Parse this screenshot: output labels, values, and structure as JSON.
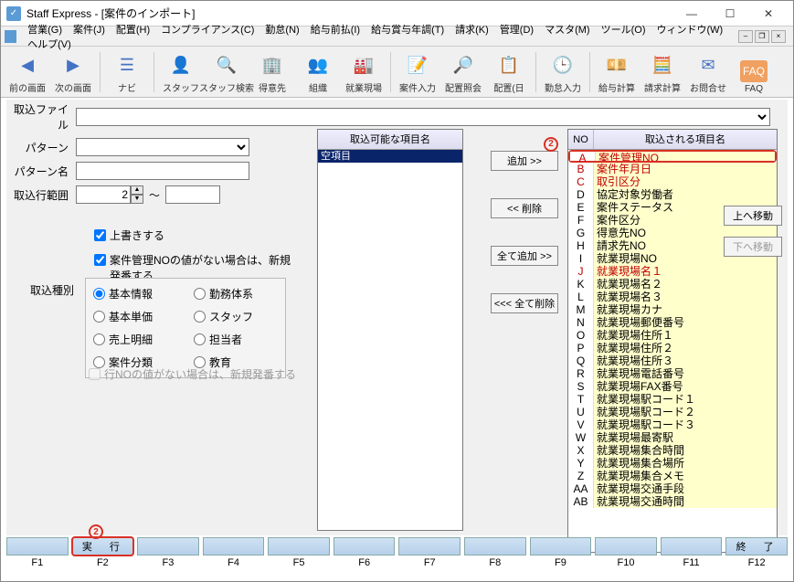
{
  "window": {
    "title": "Staff Express - [案件のインポート]"
  },
  "menus": [
    "営業(G)",
    "案件(J)",
    "配置(H)",
    "コンプライアンス(C)",
    "勤怠(N)",
    "給与前払(I)",
    "給与賞与年調(T)",
    "請求(K)",
    "管理(D)",
    "マスタ(M)",
    "ツール(O)",
    "ウィンドウ(W)",
    "ヘルプ(V)"
  ],
  "toolbar": [
    {
      "icon": "◀",
      "label": "前の画面"
    },
    {
      "icon": "▶",
      "label": "次の画面"
    },
    {
      "sep": true
    },
    {
      "icon": "☰",
      "label": "ナビ"
    },
    {
      "sep": true
    },
    {
      "icon": "👤",
      "label": "スタッフ"
    },
    {
      "icon": "🔍",
      "label": "スタッフ検索"
    },
    {
      "icon": "🏢",
      "label": "得意先"
    },
    {
      "icon": "👥",
      "label": "組織"
    },
    {
      "icon": "🏭",
      "label": "就業現場"
    },
    {
      "sep": true
    },
    {
      "icon": "📝",
      "label": "案件入力"
    },
    {
      "icon": "🔎",
      "label": "配置照会"
    },
    {
      "icon": "📋",
      "label": "配置(日"
    },
    {
      "sep": true
    },
    {
      "icon": "🕒",
      "label": "勤怠入力"
    },
    {
      "sep": true
    },
    {
      "icon": "💴",
      "label": "給与計算"
    },
    {
      "icon": "🧮",
      "label": "請求計算"
    },
    {
      "icon": "✉",
      "label": "お問合せ"
    },
    {
      "icon": "❓",
      "label": "FAQ",
      "bg": "#f0a060"
    }
  ],
  "labels": {
    "file": "取込ファイル",
    "pattern": "パターン",
    "patternName": "パターン名",
    "rowRange": "取込行範囲",
    "rangeSep": "～",
    "overwrite": "上書きする",
    "autonum": "案件管理NOの値がない場合は、新規発番する",
    "importType": "取込種別",
    "rowAutoDisabled": "行NOの値がない場合は、新規発番する"
  },
  "values": {
    "rangeFrom": "2",
    "rangeTo": ""
  },
  "radios": [
    "基本情報",
    "勤務体系",
    "基本単価",
    "スタッフ",
    "売上明細",
    "担当者",
    "案件分類",
    "教育"
  ],
  "leftList": {
    "header": "取込可能な項目名",
    "items": [
      "空項目"
    ]
  },
  "midButtons": {
    "add": "追加 >>",
    "del": "<< 削除",
    "addAll": "全て追加 >>",
    "delAll": "<<< 全て削除"
  },
  "sideButtons": {
    "up": "上へ移動",
    "down": "下へ移動"
  },
  "rightTable": {
    "colNo": "NO",
    "colName": "取込される項目名",
    "rows": [
      {
        "no": "A",
        "name": "案件管理NO",
        "red": true,
        "boxed": true
      },
      {
        "no": "B",
        "name": "案件年月日",
        "red": true
      },
      {
        "no": "C",
        "name": "取引区分",
        "red": true
      },
      {
        "no": "D",
        "name": "協定対象労働者"
      },
      {
        "no": "E",
        "name": "案件ステータス"
      },
      {
        "no": "F",
        "name": "案件区分"
      },
      {
        "no": "G",
        "name": "得意先NO"
      },
      {
        "no": "H",
        "name": "請求先NO"
      },
      {
        "no": "I",
        "name": "就業現場NO"
      },
      {
        "no": "J",
        "name": "就業現場名１",
        "red": true
      },
      {
        "no": "K",
        "name": "就業現場名２"
      },
      {
        "no": "L",
        "name": "就業現場名３"
      },
      {
        "no": "M",
        "name": "就業現場カナ"
      },
      {
        "no": "N",
        "name": "就業現場郵便番号"
      },
      {
        "no": "O",
        "name": "就業現場住所１"
      },
      {
        "no": "P",
        "name": "就業現場住所２"
      },
      {
        "no": "Q",
        "name": "就業現場住所３"
      },
      {
        "no": "R",
        "name": "就業現場電話番号"
      },
      {
        "no": "S",
        "name": "就業現場FAX番号"
      },
      {
        "no": "T",
        "name": "就業現場駅コード１"
      },
      {
        "no": "U",
        "name": "就業現場駅コード２"
      },
      {
        "no": "V",
        "name": "就業現場駅コード３"
      },
      {
        "no": "W",
        "name": "就業現場最寄駅"
      },
      {
        "no": "X",
        "name": "就業現場集合時間"
      },
      {
        "no": "Y",
        "name": "就業現場集合場所"
      },
      {
        "no": "Z",
        "name": "就業現場集合メモ"
      },
      {
        "no": "AA",
        "name": "就業現場交通手段"
      },
      {
        "no": "AB",
        "name": "就業現場交通時間"
      }
    ]
  },
  "fkeys": {
    "top": [
      "",
      "実　行",
      "",
      "",
      "",
      "",
      "",
      "",
      "",
      "",
      "",
      "終　了"
    ],
    "bottom": [
      "F1",
      "F2",
      "F3",
      "F4",
      "F5",
      "F6",
      "F7",
      "F8",
      "F9",
      "F10",
      "F11",
      "F12"
    ]
  },
  "annotations": {
    "circ2": "2"
  }
}
